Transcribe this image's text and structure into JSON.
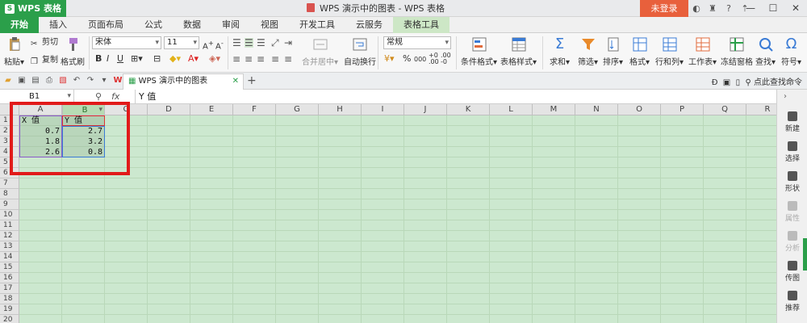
{
  "titlebar": {
    "app_button": "WPS 表格",
    "app_logo_letter": "S",
    "window_title": "WPS 演示中的图表 - WPS 表格",
    "login_button": "未登录"
  },
  "menu_tabs": [
    "开始",
    "插入",
    "页面布局",
    "公式",
    "数据",
    "审阅",
    "视图",
    "开发工具",
    "云服务",
    "表格工具"
  ],
  "ribbon": {
    "paste": "粘贴",
    "cut": "剪切",
    "copy": "复制",
    "format_painter": "格式刷",
    "font_name": "宋体",
    "font_size": "11",
    "merge_center": "合并居中",
    "wrap_text": "自动换行",
    "number_format": "常规",
    "conditional_format": "条件格式",
    "table_style": "表格样式",
    "sum": "求和",
    "filter": "筛选",
    "sort": "排序",
    "format": "格式",
    "rows_cols": "行和列",
    "worksheet": "工作表",
    "freeze": "冻结窗格",
    "find": "查找",
    "symbol": "符号",
    "percent": "%",
    "comma": "000"
  },
  "quickbar": {
    "doc_tab": "WPS 演示中的图表",
    "command_search": "点此查找命令"
  },
  "formula_bar": {
    "name_box": "B1",
    "fx": "fx",
    "content": "Y 值"
  },
  "sheet": {
    "columns": [
      "A",
      "B",
      "C",
      "D",
      "E",
      "F",
      "G",
      "H",
      "I",
      "J",
      "K",
      "L",
      "M",
      "N",
      "O",
      "P",
      "Q",
      "R"
    ],
    "rows": [
      "1",
      "2",
      "3",
      "4",
      "5",
      "6",
      "7",
      "8",
      "9",
      "10",
      "11",
      "12",
      "13",
      "14",
      "15",
      "16",
      "17",
      "18",
      "19",
      "20"
    ],
    "headers": [
      "X 值",
      "Y 值"
    ],
    "data": [
      {
        "x": "0.7",
        "y": "2.7"
      },
      {
        "x": "1.8",
        "y": "3.2"
      },
      {
        "x": "2.6",
        "y": "0.8"
      }
    ]
  },
  "task_pane": [
    "新建",
    "选择",
    "形状",
    "属性",
    "分析",
    "传图",
    "推荐"
  ]
}
